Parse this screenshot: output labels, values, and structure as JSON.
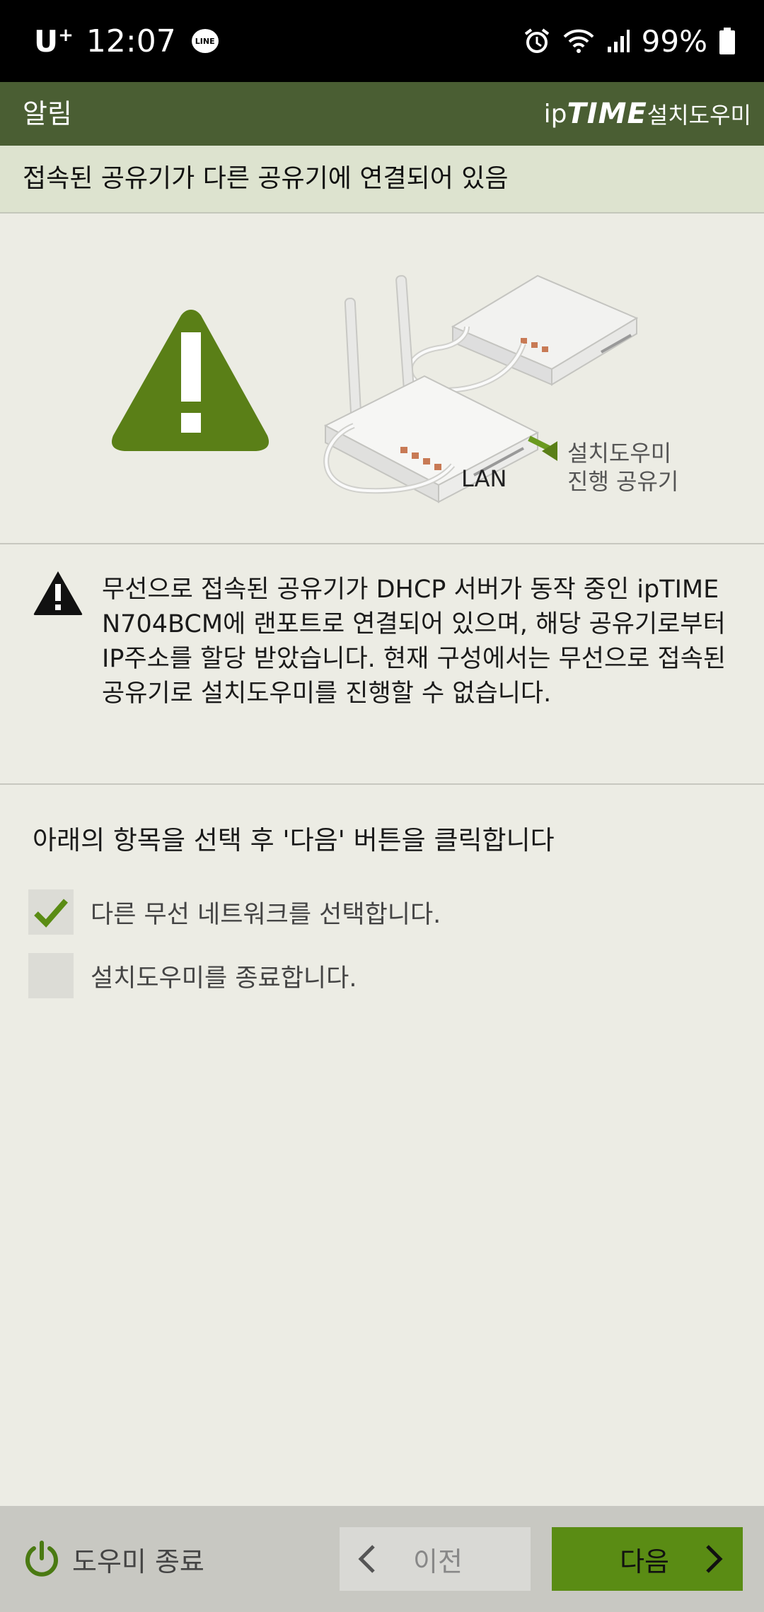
{
  "status_bar": {
    "carrier": "U",
    "carrier_sup": "+",
    "time": "12:07",
    "line_badge": "LINE",
    "battery": "99%"
  },
  "header": {
    "title": "알림",
    "brand_ip": "ip",
    "brand_time": "TIME",
    "brand_wizard": "설치도우미"
  },
  "subheader": {
    "text": "접속된 공유기가 다른 공유기에 연결되어 있음"
  },
  "illustration": {
    "lan_label": "LAN",
    "router_label_line1": "설치도우미",
    "router_label_line2": "진행 공유기"
  },
  "info": {
    "message": "무선으로 접속된 공유기가 DHCP 서버가 동작 중인 ipTIME N704BCM에 랜포트로 연결되어 있으며, 해당 공유기로부터 IP주소를 할당 받았습니다. 현재 구성에서는 무선으로 접속된 공유기로 설치도우미를 진행할 수 없습니다."
  },
  "instruction": "아래의 항목을 선택 후 '다음' 버튼을 클릭합니다",
  "options": [
    {
      "label": "다른 무선 네트워크를 선택합니다.",
      "checked": true
    },
    {
      "label": "설치도우미를 종료합니다.",
      "checked": false
    }
  ],
  "bottom": {
    "exit_label": "도우미 종료",
    "prev_label": "이전",
    "next_label": "다음"
  },
  "colors": {
    "header_bg": "#4a5e33",
    "accent_green": "#5a8c14",
    "warning_green": "#5a7f17"
  }
}
